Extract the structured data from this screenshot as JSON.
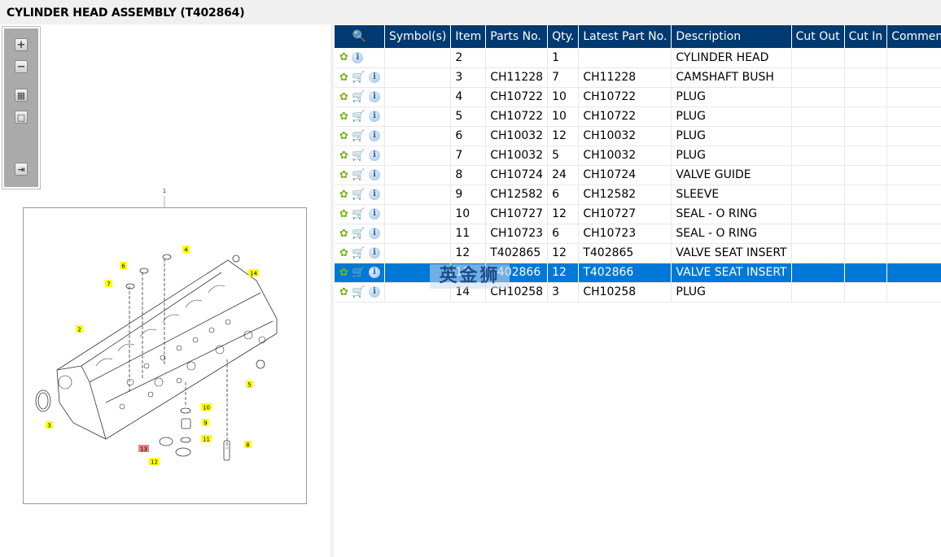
{
  "title": "CYLINDER HEAD ASSEMBLY (T402864)",
  "toolbar": {
    "zoom_in": "+",
    "zoom_out": "−",
    "fit_all": "▦",
    "fit_window": "□",
    "export": "⇥"
  },
  "drawing": {
    "figure_label": "1",
    "callouts": [
      "2",
      "3",
      "4",
      "5",
      "6",
      "7",
      "8",
      "9",
      "10",
      "11",
      "12",
      "13",
      "14"
    ],
    "highlight_callout": "13",
    "callout_color": "#ffff00",
    "highlight_color": "#f08080"
  },
  "table": {
    "headers": [
      "Symbol(s)",
      "Item",
      "Parts No.",
      "Qty.",
      "Latest Part No.",
      "Description",
      "Cut Out",
      "Cut In",
      "Comment"
    ],
    "rows": [
      {
        "item": "2",
        "part": "",
        "qty": "1",
        "latest": "",
        "desc": "CYLINDER HEAD",
        "cart": false
      },
      {
        "item": "3",
        "part": "CH11228",
        "qty": "7",
        "latest": "CH11228",
        "desc": "CAMSHAFT BUSH",
        "cart": true
      },
      {
        "item": "4",
        "part": "CH10722",
        "qty": "10",
        "latest": "CH10722",
        "desc": "PLUG",
        "cart": true
      },
      {
        "item": "5",
        "part": "CH10722",
        "qty": "10",
        "latest": "CH10722",
        "desc": "PLUG",
        "cart": true
      },
      {
        "item": "6",
        "part": "CH10032",
        "qty": "12",
        "latest": "CH10032",
        "desc": "PLUG",
        "cart": true
      },
      {
        "item": "7",
        "part": "CH10032",
        "qty": "5",
        "latest": "CH10032",
        "desc": "PLUG",
        "cart": true
      },
      {
        "item": "8",
        "part": "CH10724",
        "qty": "24",
        "latest": "CH10724",
        "desc": "VALVE GUIDE",
        "cart": true
      },
      {
        "item": "9",
        "part": "CH12582",
        "qty": "6",
        "latest": "CH12582",
        "desc": "SLEEVE",
        "cart": true
      },
      {
        "item": "10",
        "part": "CH10727",
        "qty": "12",
        "latest": "CH10727",
        "desc": "SEAL - O RING",
        "cart": true
      },
      {
        "item": "11",
        "part": "CH10723",
        "qty": "6",
        "latest": "CH10723",
        "desc": "SEAL - O RING",
        "cart": true
      },
      {
        "item": "12",
        "part": "T402865",
        "qty": "12",
        "latest": "T402865",
        "desc": "VALVE SEAT INSERT",
        "cart": true
      },
      {
        "item": "13",
        "part": "T402866",
        "qty": "12",
        "latest": "T402866",
        "desc": "VALVE SEAT INSERT",
        "cart": true,
        "selected": true
      },
      {
        "item": "14",
        "part": "CH10258",
        "qty": "3",
        "latest": "CH10258",
        "desc": "PLUG",
        "cart": true
      }
    ]
  },
  "watermark": "英金狮",
  "colors": {
    "header_bg": "#003a70",
    "selected_bg": "#0078d7"
  }
}
